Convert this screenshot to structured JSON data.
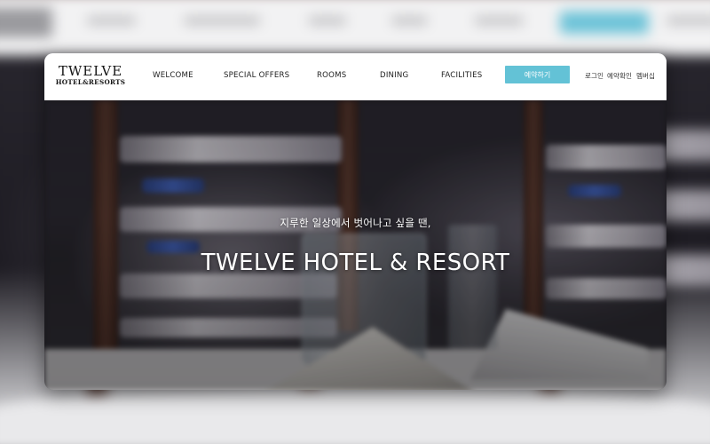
{
  "brand": {
    "name": "TWELVE",
    "tagline": "HOTEL&RESORTS"
  },
  "nav": {
    "items": [
      {
        "label": "WELCOME"
      },
      {
        "label": "SPECIAL OFFERS"
      },
      {
        "label": "ROOMS"
      },
      {
        "label": "DINING"
      },
      {
        "label": "FACILITIES"
      }
    ],
    "reserve_label": "예약하기",
    "utility": [
      {
        "label": "로그인"
      },
      {
        "label": "예약확인"
      },
      {
        "label": "멤버십"
      }
    ]
  },
  "hero": {
    "subtitle": "지루한 일상에서 벗어나고 싶을 땐,",
    "title": "TWELVE HOTEL & RESORT"
  },
  "colors": {
    "accent": "#63c2d6",
    "nav_bg": "#ffffff",
    "text": "#222222"
  }
}
